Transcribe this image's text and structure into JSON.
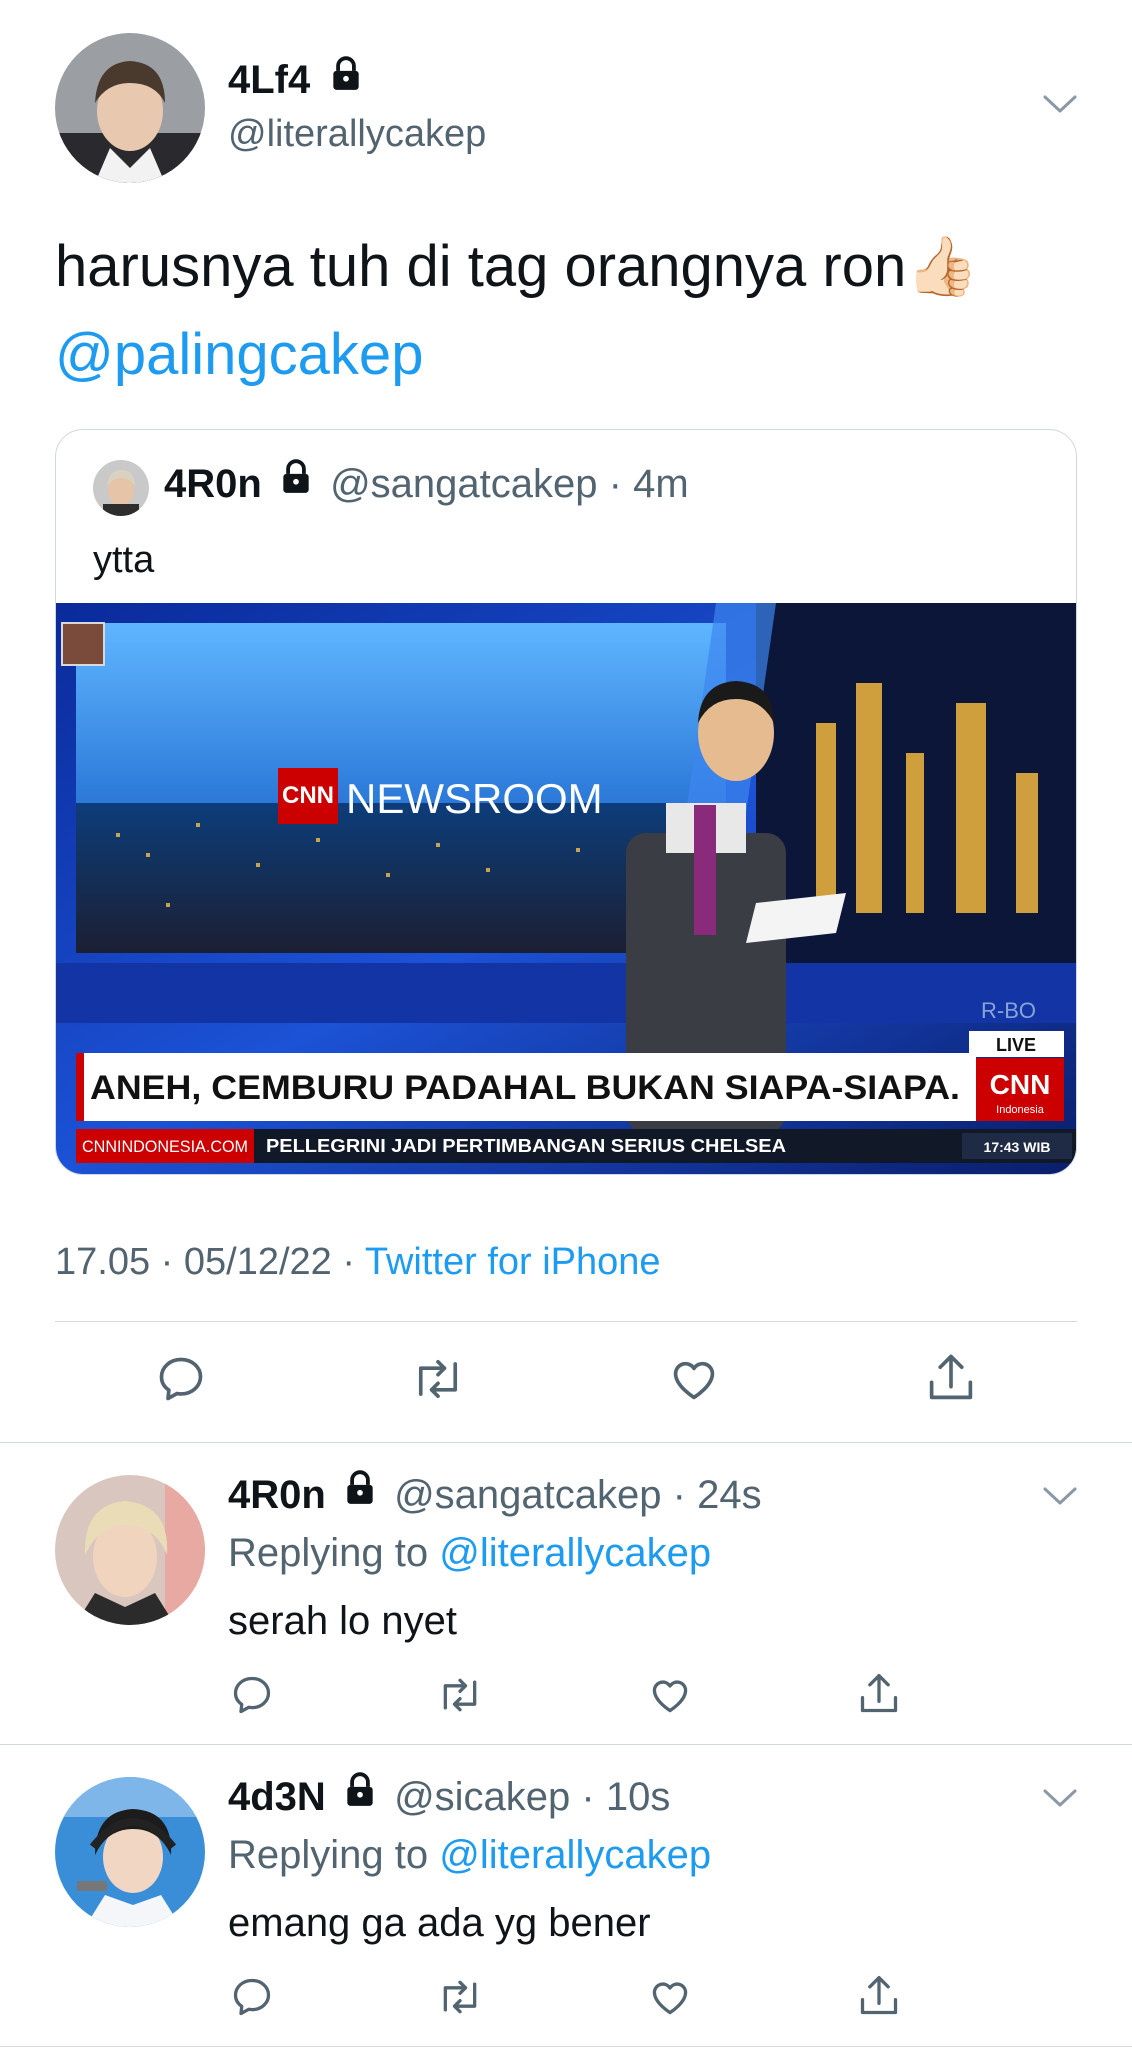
{
  "main_tweet": {
    "display_name": "4Lf4",
    "handle": "@literallycakep",
    "text": "harusnya tuh di tag orangnya ron",
    "emoji": "👍🏻",
    "mention": "@palingcakep",
    "quote": {
      "display_name": "4R0n",
      "handle": "@sangatcakep",
      "time": "· 4m",
      "text": "ytta",
      "image": {
        "brand": "CNN",
        "brand_sub": "Indonesia",
        "newsroom": "NEWSROOM",
        "headline": "ANEH, CEMBURU PADAHAL BUKAN SIAPA-SIAPA.",
        "live": "LIVE",
        "site": "CNNINDONESIA.COM",
        "ticker": "PELLEGRINI JADI PERTIMBANGAN SERIUS CHELSEA",
        "clock": "17:43 WIB",
        "corner": "R-BO"
      }
    },
    "timestamp": "17.05 · 05/12/22 ·",
    "source": "Twitter for iPhone"
  },
  "replies": [
    {
      "display_name": "4R0n",
      "handle": "@sangatcakep",
      "time": "· 24s",
      "replying_label": "Replying to",
      "replying_to": "@literallycakep",
      "text": "serah lo nyet"
    },
    {
      "display_name": "4d3N",
      "handle": "@sicakep",
      "time": "· 10s",
      "replying_label": "Replying to",
      "replying_to": "@literallycakep",
      "text": "emang ga ada yg bener"
    }
  ],
  "colors": {
    "accent": "#1d9bf0",
    "text": "#0f1419",
    "secondary": "#536471",
    "divider": "#cfd9de"
  },
  "icons": [
    "lock-icon",
    "chevron-down-icon",
    "reply-icon",
    "retweet-icon",
    "like-icon",
    "share-icon"
  ]
}
